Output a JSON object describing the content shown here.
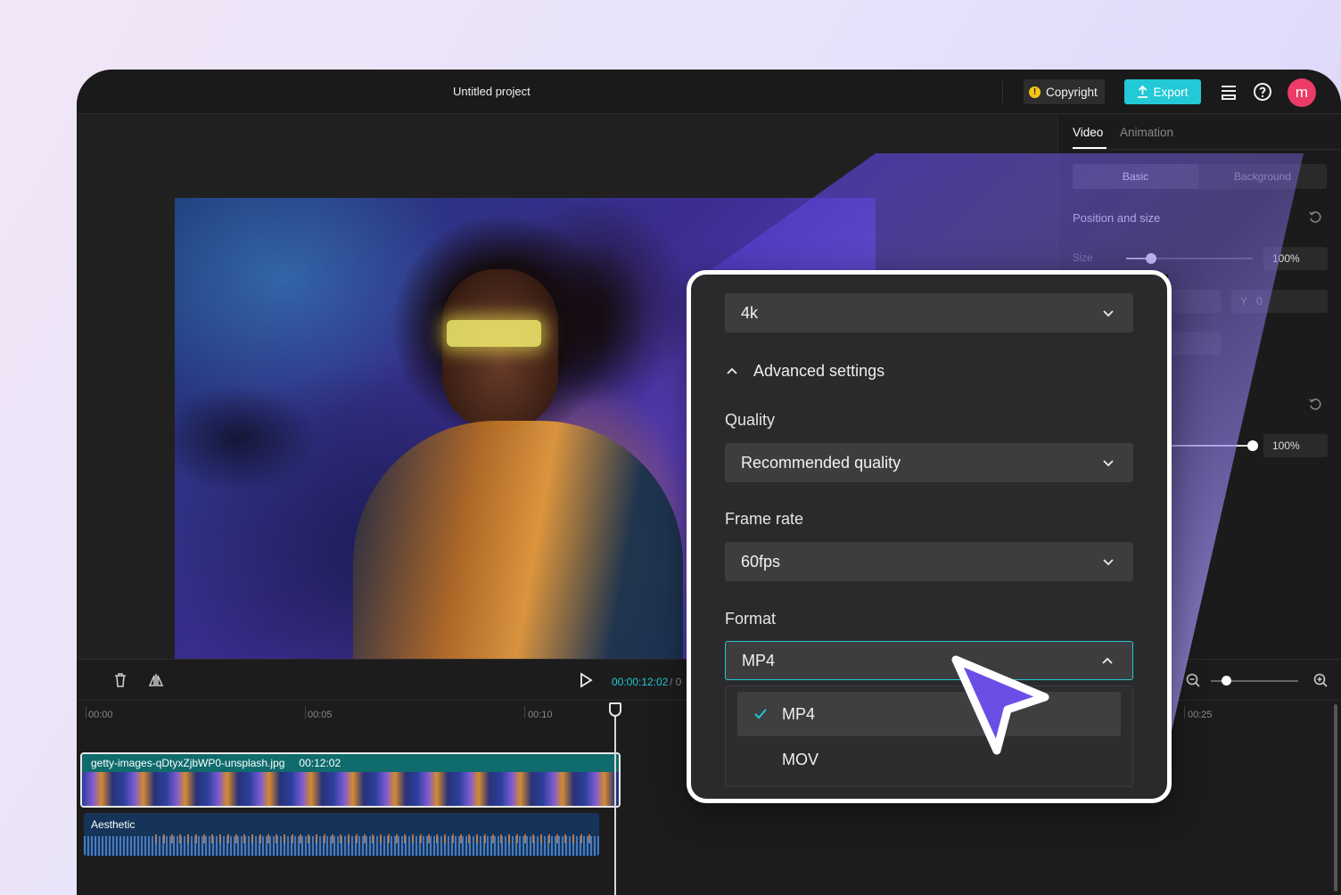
{
  "app": {
    "project_title": "Untitled project",
    "copyright_label": "Copyright",
    "export_label": "Export",
    "avatar_letter": "m"
  },
  "right_panel": {
    "tabs": [
      "Video",
      "Animation"
    ],
    "segments": [
      "Basic",
      "Background"
    ],
    "section_title": "Position and size",
    "size_label": "Size",
    "size_value": "100%",
    "y_label": "Y",
    "y_value": "0",
    "opacity_value": "100%"
  },
  "timeline": {
    "current_time": "00:00:12:02",
    "time_separator": "/ 0",
    "ruler": [
      "00:00",
      "00:05",
      "00:10",
      "00:25"
    ],
    "video_clip": {
      "name": "getty-images-qDtyxZjbWP0-unsplash.jpg",
      "duration": "00:12:02"
    },
    "audio_clip": {
      "name": "Aesthetic"
    }
  },
  "export_popup": {
    "resolution": "4k",
    "advanced_label": "Advanced settings",
    "quality_label": "Quality",
    "quality_value": "Recommended quality",
    "frame_rate_label": "Frame rate",
    "frame_rate_value": "60fps",
    "format_label": "Format",
    "format_value": "MP4",
    "format_options": [
      "MP4",
      "MOV"
    ],
    "selected_format": "MP4"
  },
  "colors": {
    "accent": "#23c9d6",
    "avatar": "#ec3b67",
    "cursor": "#6b4ee6",
    "warning": "#f5c518"
  },
  "icons": [
    "warning-icon",
    "upload-icon",
    "layers-icon",
    "help-icon",
    "reset-icon",
    "trash-icon",
    "mirror-icon",
    "play-icon",
    "zoom-out-icon",
    "zoom-in-icon",
    "chevron-down-icon",
    "chevron-up-icon",
    "check-icon",
    "cursor-arrow-icon"
  ]
}
